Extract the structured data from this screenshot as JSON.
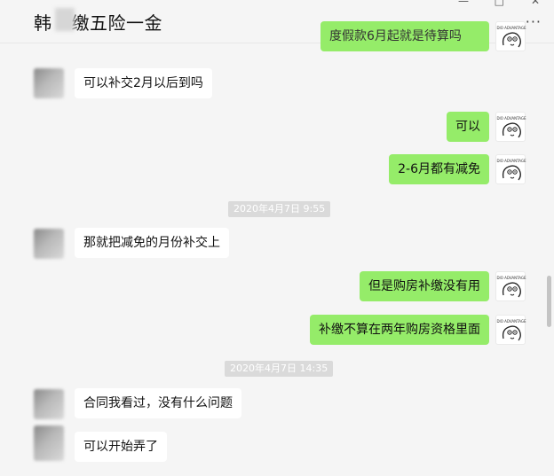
{
  "header": {
    "title_prefix": "韩",
    "title_suffix": "缴五险一金",
    "more_label": "···",
    "min_label": "—",
    "max_label": "□",
    "close_label": "✕"
  },
  "chat": {
    "top_partial_text": "度假款6月起就是待算吗",
    "messages": [
      {
        "dir": "in",
        "text": "可以补交2月以后到吗"
      },
      {
        "dir": "out",
        "text": "可以"
      },
      {
        "dir": "out",
        "text": "2-6月都有减免"
      },
      {
        "dir": "time",
        "text": "2020年4月7日 9:55"
      },
      {
        "dir": "in",
        "text": "那就把减免的月份补交上"
      },
      {
        "dir": "out",
        "text": "但是购房补缴没有用"
      },
      {
        "dir": "out",
        "text": "补缴不算在两年购房资格里面"
      },
      {
        "dir": "time",
        "text": "2020年4月7日 14:35"
      },
      {
        "dir": "in",
        "text": "合同我看过，没有什么问题"
      },
      {
        "dir": "in",
        "text": "可以开始弄了"
      }
    ]
  },
  "colors": {
    "outgoing_bubble": "#95ec69",
    "incoming_bubble": "#ffffff",
    "background": "#f5f5f5",
    "timestamp_bg": "#dadada"
  }
}
